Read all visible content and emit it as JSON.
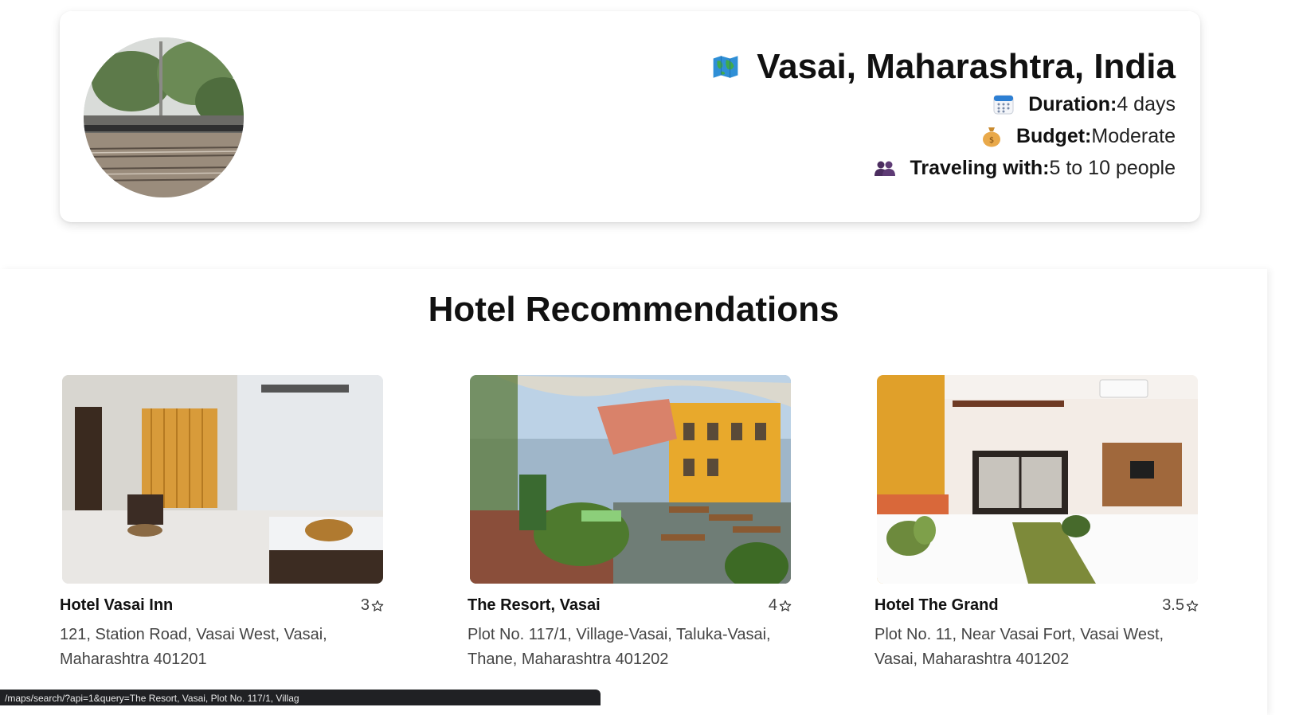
{
  "trip": {
    "destination": "Vasai, Maharashtra, India",
    "duration_label": "Duration:",
    "duration_value": "4 days",
    "budget_label": "Budget:",
    "budget_value": "Moderate",
    "travelers_label": "Traveling with:",
    "travelers_value": "5 to 10 people"
  },
  "icons": {
    "destination": "world-map-icon",
    "duration": "calendar-icon",
    "budget": "money-bag-icon",
    "travelers": "people-icon",
    "rating": "star-outline-icon"
  },
  "hotels_section": {
    "title": "Hotel Recommendations",
    "hotels": [
      {
        "name": "Hotel Vasai Inn",
        "rating": "3",
        "address": "121, Station Road, Vasai West, Vasai, Maharashtra 401201"
      },
      {
        "name": "The Resort, Vasai",
        "rating": "4",
        "address": "Plot No. 117/1, Village-Vasai, Taluka-Vasai, Thane, Maharashtra 401202"
      },
      {
        "name": "Hotel The Grand",
        "rating": "3.5",
        "address": "Plot No. 11, Near Vasai Fort, Vasai West, Vasai, Maharashtra 401202"
      }
    ]
  },
  "status_bar": {
    "url": "/maps/search/?api=1&query=The Resort, Vasai, Plot No. 117/1, Villag"
  }
}
